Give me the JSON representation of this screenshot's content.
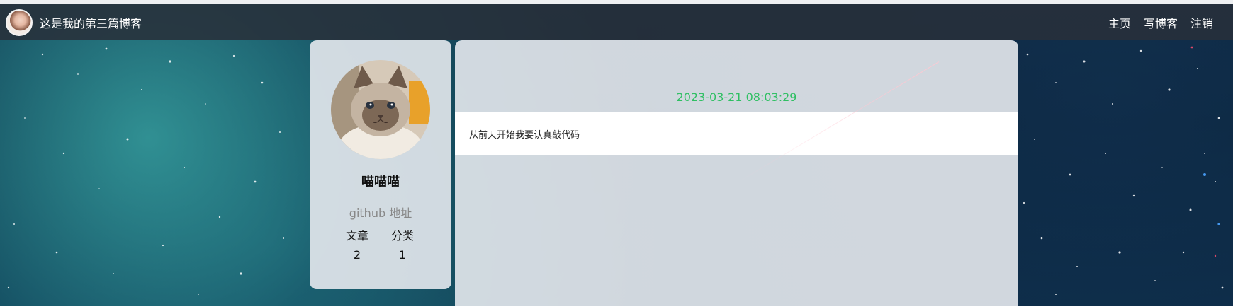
{
  "nav": {
    "title": "这是我的第三篇博客",
    "links": [
      "主页",
      "写博客",
      "注销"
    ]
  },
  "profile": {
    "name": "喵喵喵",
    "github_label": "github 地址",
    "stats": [
      {
        "label": "文章",
        "value": "2"
      },
      {
        "label": "分类",
        "value": "1"
      }
    ]
  },
  "post": {
    "date": "2023-03-21 08:03:29",
    "content": "从前天开始我要认真敲代码"
  },
  "colors": {
    "nav_bg": "#28303a",
    "date_green": "#2fbf63",
    "card_bg": "#e2e6ec"
  },
  "icons": {
    "nav_avatar": "user-avatar-icon",
    "profile_avatar": "cat-avatar-icon"
  }
}
